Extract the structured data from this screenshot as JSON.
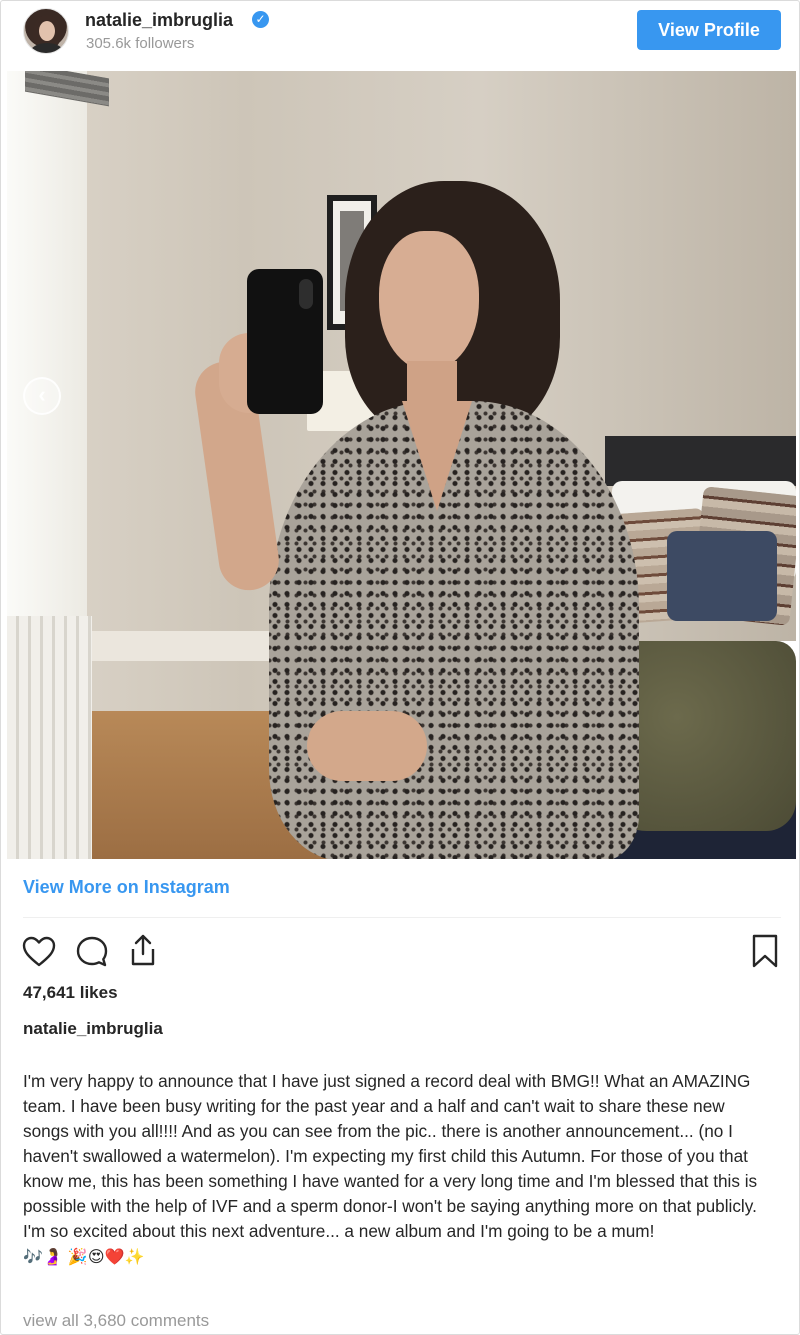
{
  "header": {
    "username": "natalie_imbruglia",
    "verified_mark": "✓",
    "followers": "305.6k followers",
    "view_profile_label": "View Profile"
  },
  "post": {
    "carousel_prev": "‹",
    "view_more_label": "View More on Instagram",
    "likes": "47,641 likes",
    "caption_username": "natalie_imbruglia",
    "caption_text": "I'm very happy to announce that I have just signed a record deal with BMG!! What an AMAZING team. I have been busy writing for the past year and a half and can't wait to share these new songs with you all!!!! And as you can see from the pic.. there is another announcement... (no I haven't swallowed a watermelon). I'm expecting my first child this Autumn. For those of you that know me, this has been something I have wanted for a very long time and I'm blessed that this is possible with the help of IVF and a sperm donor-I won't be saying anything more on that publicly. I'm so excited about this next adventure... a new album and I'm going to be a mum! ",
    "caption_emojis": "🎶🤰 🎉😍❤️✨",
    "comments_link": "view all 3,680 comments"
  },
  "colors": {
    "accent": "#3897f0",
    "muted_text": "#999999",
    "text": "#262626"
  },
  "icons": [
    "heart-icon",
    "comment-icon",
    "share-icon",
    "bookmark-icon",
    "verified-badge-icon",
    "chevron-left-icon"
  ]
}
